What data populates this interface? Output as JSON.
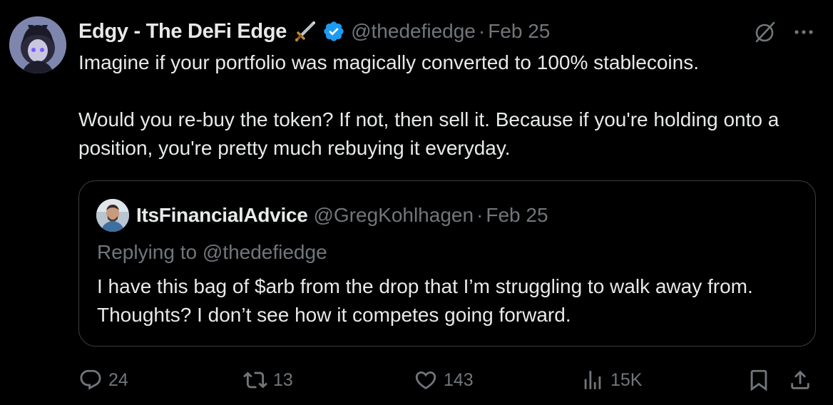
{
  "tweet": {
    "author_name": "Edgy - The DeFi Edge",
    "handle": "@thedefiedge",
    "separator": "·",
    "date": "Feb 25",
    "paragraphs": [
      "Imagine if your portfolio was magically converted to 100% stablecoins.",
      "Would you re-buy the token? If not, then sell it. Because if you're holding onto a position, you're pretty much rebuying it everyday."
    ]
  },
  "quote": {
    "author_name": "ItsFinancialAdvice",
    "handle": "@GregKohlhagen",
    "separator": "·",
    "date": "Feb 25",
    "replying_to": "Replying to @thedefiedge",
    "text": "I have this bag of $arb from the drop that I’m struggling to walk away from. Thoughts? I don’t see how it competes going forward."
  },
  "actions": {
    "replies": "24",
    "reposts": "13",
    "likes": "143",
    "views": "15K"
  },
  "colors": {
    "background": "#000000",
    "text": "#e7e9ea",
    "muted": "#71767b",
    "verified": "#1d9bf0",
    "border": "#3a3f44"
  },
  "icons": [
    "sword-emoji-icon",
    "verified-badge-icon",
    "grok-icon",
    "more-icon",
    "reply-icon",
    "repost-icon",
    "like-icon",
    "views-icon",
    "bookmark-icon",
    "share-icon"
  ]
}
